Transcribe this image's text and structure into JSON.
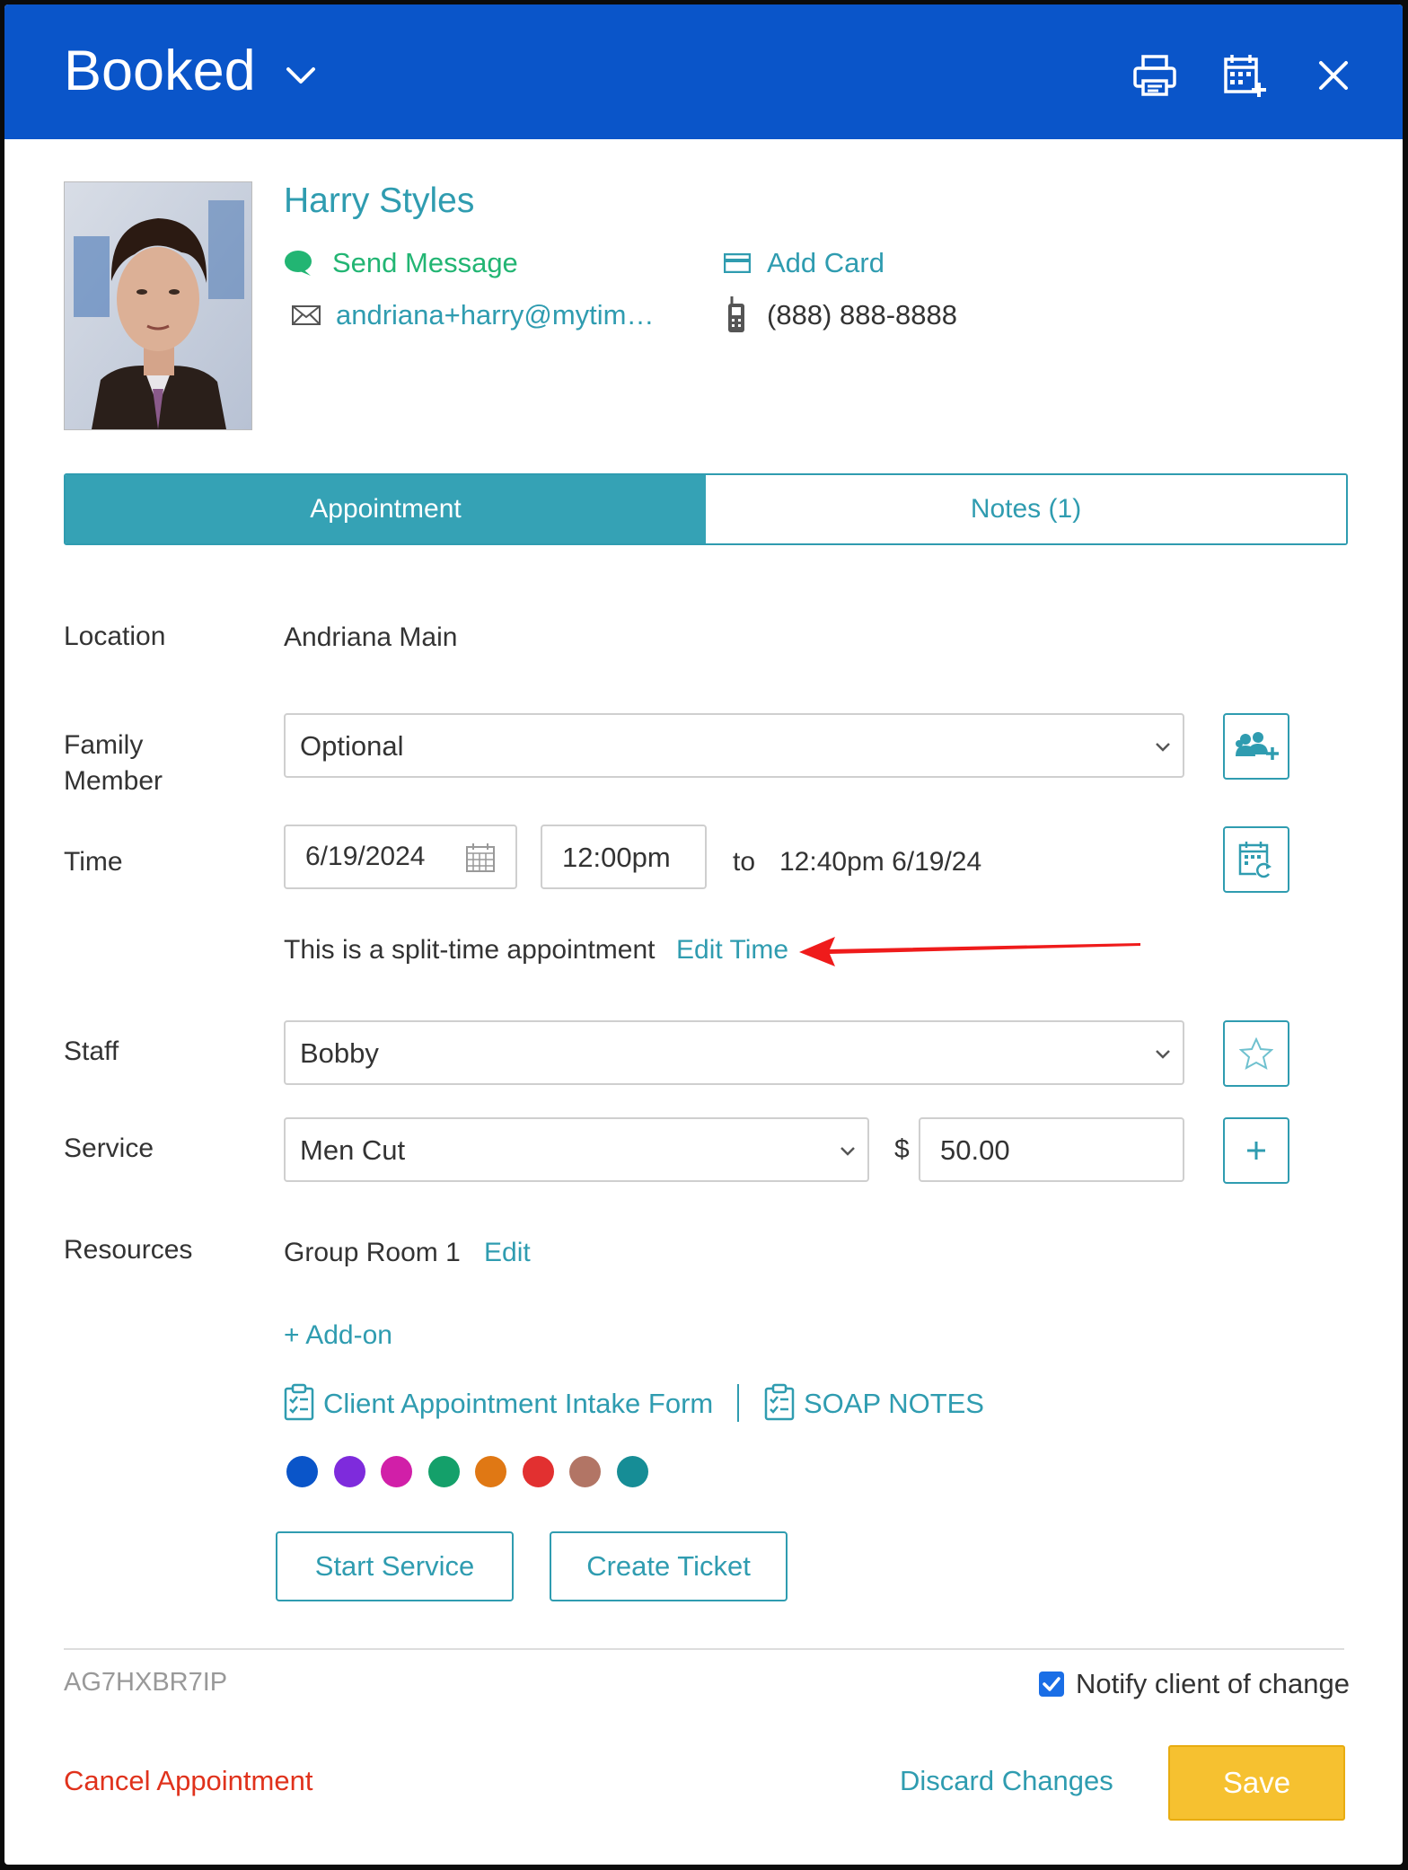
{
  "header": {
    "status_title": "Booked",
    "bg_color": "#0a55c9",
    "icons": [
      "print-icon",
      "calendar-add-icon",
      "close-icon"
    ]
  },
  "client": {
    "name": "Harry Styles",
    "send_message": "Send Message",
    "add_card": "Add Card",
    "email": "andriana+harry@mytim…",
    "phone": "(888) 888-8888"
  },
  "tabs": [
    {
      "label": "Appointment",
      "active": true
    },
    {
      "label": "Notes (1)",
      "active": false
    }
  ],
  "form": {
    "location_label": "Location",
    "location_value": "Andriana Main",
    "family_label": "Family Member",
    "family_value": "Optional",
    "time_label": "Time",
    "date_value": "6/19/2024",
    "time_value": "12:00pm",
    "to_label": "to",
    "end_value": "12:40pm 6/19/24",
    "split_text": "This is a split-time appointment",
    "edit_time": "Edit Time",
    "staff_label": "Staff",
    "staff_value": "Bobby",
    "service_label": "Service",
    "service_value": "Men Cut",
    "currency": "$",
    "price_value": "50.00",
    "resources_label": "Resources",
    "resources_value": "Group Room 1",
    "resources_edit": "Edit",
    "addon": "+ Add-on",
    "intake_form": "Client Appointment Intake Form",
    "soap_notes": "SOAP NOTES"
  },
  "colors": [
    "#0a55c9",
    "#7e2bdc",
    "#d11fa8",
    "#14a06a",
    "#e07814",
    "#e23030",
    "#b27565",
    "#168d96"
  ],
  "actions": {
    "start_service": "Start Service",
    "create_ticket": "Create Ticket"
  },
  "footer": {
    "code": "AG7HXBR7IP",
    "notify_label": "Notify client of change",
    "notify_checked": true,
    "cancel": "Cancel Appointment",
    "discard": "Discard Changes",
    "save": "Save"
  }
}
